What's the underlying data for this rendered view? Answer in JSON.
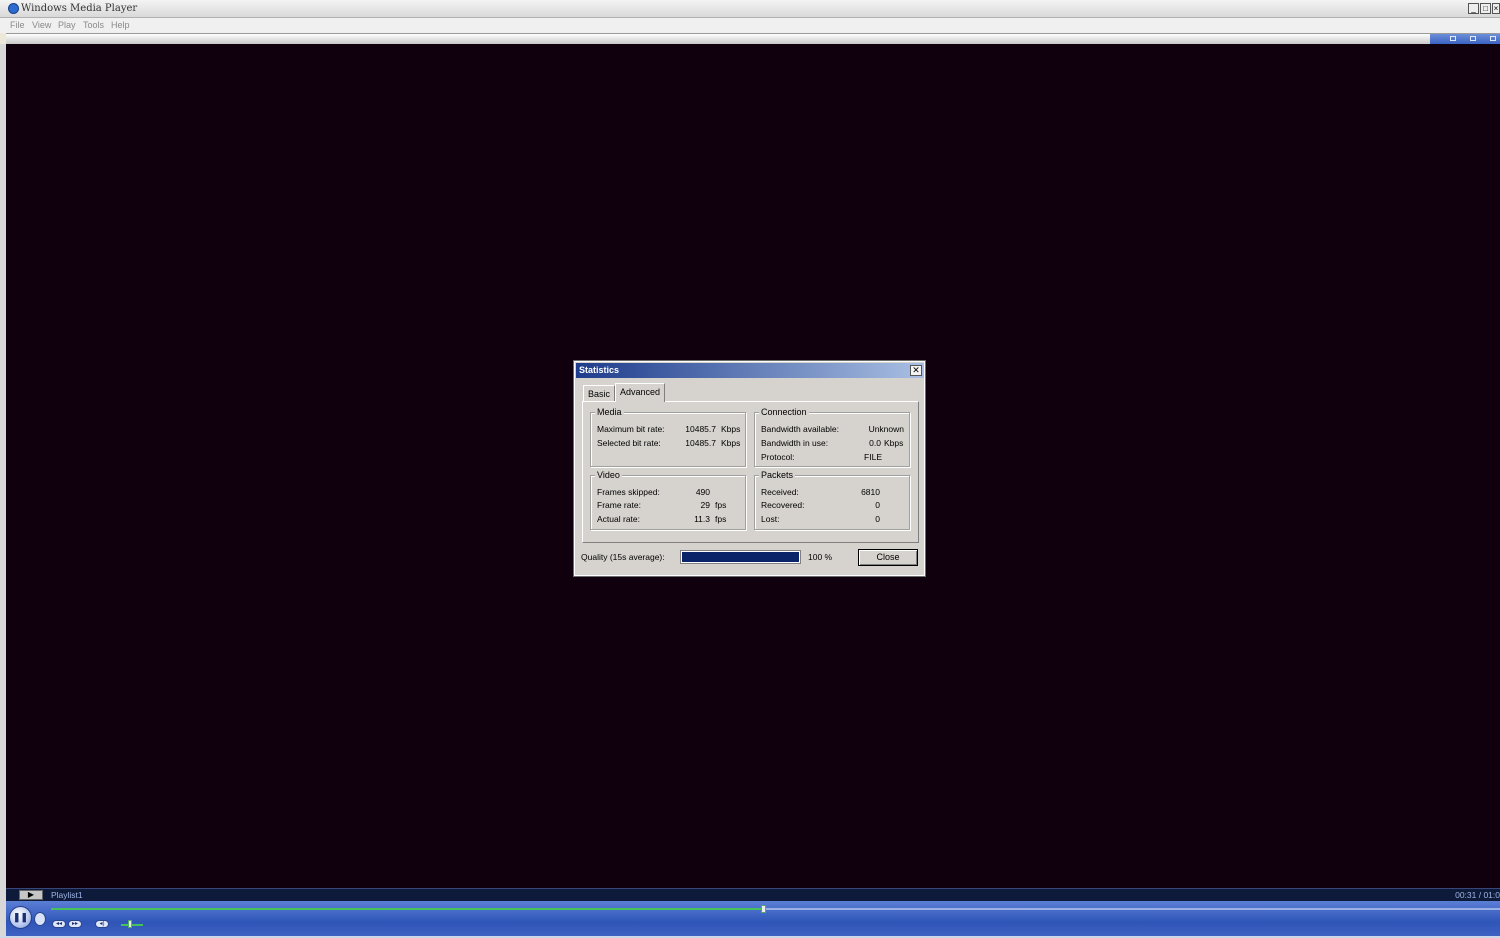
{
  "window": {
    "title": "Windows Media Player"
  },
  "menu": [
    "File",
    "View",
    "Play",
    "Tools",
    "Help"
  ],
  "dialog": {
    "title": "Statistics",
    "tabs": [
      {
        "label": "Basic",
        "active": false
      },
      {
        "label": "Advanced",
        "active": true
      }
    ],
    "media": {
      "label": "Media",
      "rows": [
        {
          "label": "Maximum bit rate:",
          "value": "10485.7",
          "unit": "Kbps"
        },
        {
          "label": "Selected bit rate:",
          "value": "10485.7",
          "unit": "Kbps"
        }
      ]
    },
    "connection": {
      "label": "Connection",
      "rows": [
        {
          "label": "Bandwidth available:",
          "value": "Unknown",
          "unit": ""
        },
        {
          "label": "Bandwidth in use:",
          "value": "0.0",
          "unit": "Kbps"
        },
        {
          "label": "Protocol:",
          "value": "FILE",
          "unit": ""
        }
      ]
    },
    "video": {
      "label": "Video",
      "rows": [
        {
          "label": "Frames skipped:",
          "value": "490",
          "unit": ""
        },
        {
          "label": "Frame rate:",
          "value": "29",
          "unit": "fps"
        },
        {
          "label": "Actual rate:",
          "value": "11.3",
          "unit": "fps"
        }
      ]
    },
    "packets": {
      "label": "Packets",
      "rows": [
        {
          "label": "Received:",
          "value": "6810",
          "unit": ""
        },
        {
          "label": "Recovered:",
          "value": "0",
          "unit": ""
        },
        {
          "label": "Lost:",
          "value": "0",
          "unit": ""
        }
      ]
    },
    "quality": {
      "label": "Quality (15s average):",
      "percent_text": "100 %",
      "fraction": 1.0
    },
    "close_label": "Close"
  },
  "player": {
    "playlist": "Playlist1",
    "time": "00:31 / 01:0",
    "seek_fraction": 0.49,
    "volume_fraction": 0.3
  },
  "colors": {
    "video_bg": "#10000e",
    "progress_fill": "#0a246a",
    "seek_fill": "#45c25a"
  }
}
